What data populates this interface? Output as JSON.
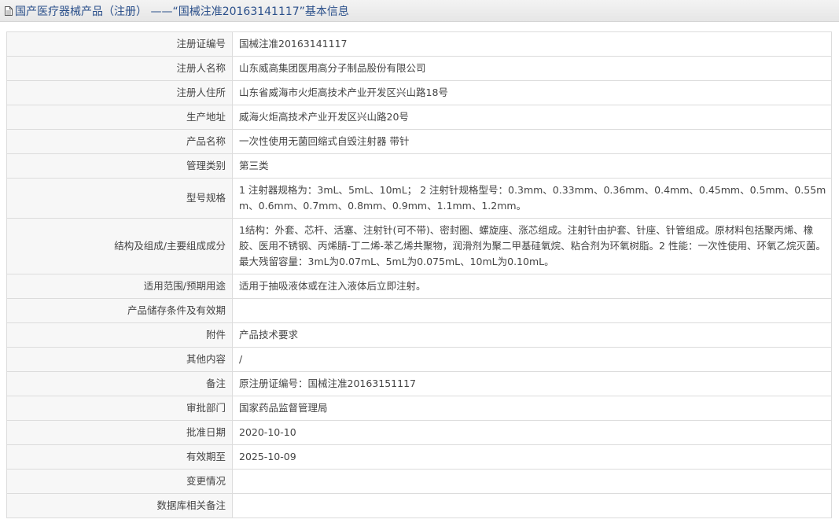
{
  "header": {
    "title": "国产医疗器械产品（注册） ——“国械注准20163141117”基本信息",
    "icon": "document-icon"
  },
  "colors": {
    "title_text": "#2a4f8a",
    "label_bg": "#f7f7f7",
    "border": "#dcdcdc"
  },
  "rows": [
    {
      "label": "注册证编号",
      "value": "国械注准20163141117"
    },
    {
      "label": "注册人名称",
      "value": "山东威高集团医用高分子制品股份有限公司"
    },
    {
      "label": "注册人住所",
      "value": "山东省威海市火炬高技术产业开发区兴山路18号"
    },
    {
      "label": "生产地址",
      "value": "威海火炬高技术产业开发区兴山路20号"
    },
    {
      "label": "产品名称",
      "value": "一次性使用无菌回缩式自毁注射器 带针"
    },
    {
      "label": "管理类别",
      "value": "第三类"
    },
    {
      "label": "型号规格",
      "value": "1 注射器规格为：3mL、5mL、10mL；  2 注射针规格型号：0.3mm、0.33mm、0.36mm、0.4mm、0.45mm、0.5mm、0.55mm、0.6mm、0.7mm、0.8mm、0.9mm、1.1mm、1.2mm。"
    },
    {
      "label": "结构及组成/主要组成成分",
      "value": "1结构：外套、芯杆、活塞、注射针(可不带)、密封圈、螺旋座、涨芯组成。注射针由护套、针座、针管组成。原材料包括聚丙烯、橡胶、医用不锈钢、丙烯腈-丁二烯-苯乙烯共聚物，润滑剂为聚二甲基硅氧烷、粘合剂为环氧树脂。2 性能：一次性使用、环氧乙烷灭菌。最大残留容量：3mL为0.07mL、5mL为0.075mL、10mL为0.10mL。"
    },
    {
      "label": "适用范围/预期用途",
      "value": "适用于抽吸液体或在注入液体后立即注射。"
    },
    {
      "label": "产品储存条件及有效期",
      "value": ""
    },
    {
      "label": "附件",
      "value": "产品技术要求"
    },
    {
      "label": "其他内容",
      "value": "/"
    },
    {
      "label": "备注",
      "value": "原注册证编号：国械注准20163151117"
    },
    {
      "label": "审批部门",
      "value": "国家药品监督管理局"
    },
    {
      "label": "批准日期",
      "value": "2020-10-10"
    },
    {
      "label": "有效期至",
      "value": "2025-10-09"
    },
    {
      "label": "变更情况",
      "value": ""
    },
    {
      "label": "数据库相关备注",
      "value": ""
    }
  ]
}
